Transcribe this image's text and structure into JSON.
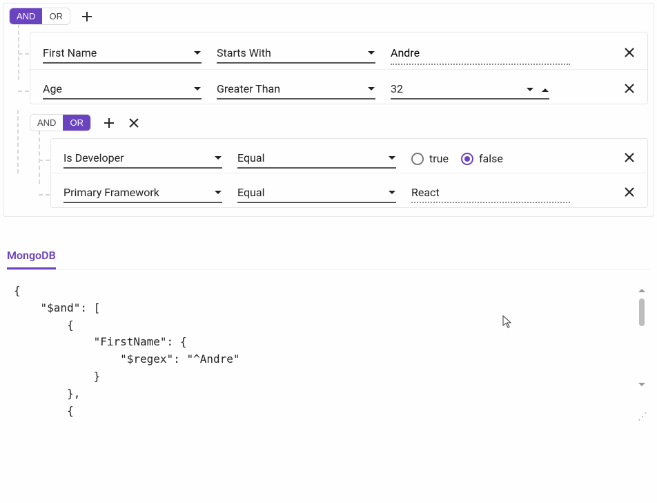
{
  "colors": {
    "accent": "#6a43c1"
  },
  "labels": {
    "and": "AND",
    "or": "OR"
  },
  "root": {
    "active_logic": "and",
    "rules": {
      "r1": {
        "field": "First Name",
        "operator": "Starts With",
        "value": "Andre"
      },
      "r2": {
        "field": "Age",
        "operator": "Greater Than",
        "value": "32"
      }
    },
    "child_group": {
      "active_logic": "or",
      "rules": {
        "r3": {
          "field": "Is Developer",
          "operator": "Equal",
          "true_label": "true",
          "false_label": "false",
          "selected": "false"
        },
        "r4": {
          "field": "Primary Framework",
          "operator": "Equal",
          "value": "React"
        }
      }
    }
  },
  "output": {
    "tab_label": "MongoDB",
    "code": "{\n    \"$and\": [\n        {\n            \"FirstName\": {\n                \"$regex\": \"^Andre\"\n            }\n        },\n        {"
  }
}
